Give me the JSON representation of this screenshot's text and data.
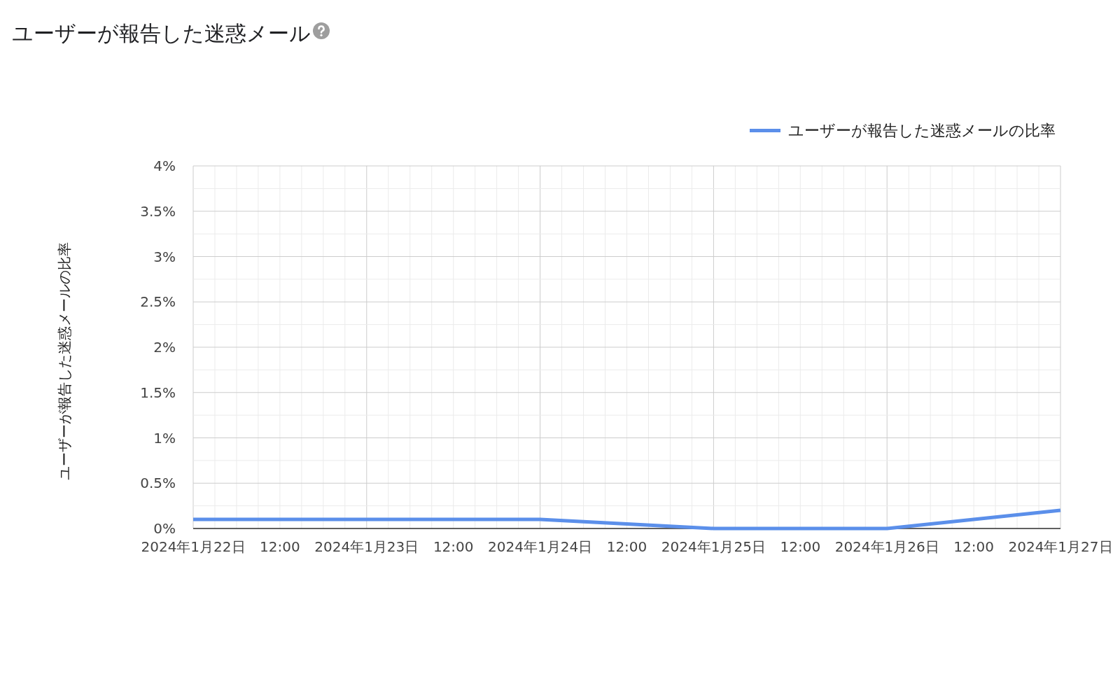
{
  "title": "ユーザーが報告した迷惑メール",
  "chart": {
    "chart_data": {
      "type": "line",
      "ylabel": "ユーザーが報告した迷惑メールの比率",
      "categories": [
        "2024年1月22日",
        "12:00",
        "2024年1月23日",
        "12:00",
        "2024年1月24日",
        "12:00",
        "2024年1月25日",
        "12:00",
        "2024年1月26日",
        "12:00",
        "2024年1月27日"
      ],
      "series": [
        {
          "name": "ユーザーが報告した迷惑メールの比率",
          "color": "#5b8fea",
          "values": [
            0.1,
            0.1,
            0.1,
            0.1,
            0.1,
            0.05,
            0,
            0,
            0,
            0.1,
            0.2
          ]
        }
      ],
      "ylim": [
        0,
        4
      ],
      "grid": true,
      "yticks": [
        {
          "value": 0,
          "label": "0%"
        },
        {
          "value": 0.5,
          "label": "0.5%"
        },
        {
          "value": 1,
          "label": "1%"
        },
        {
          "value": 1.5,
          "label": "1.5%"
        },
        {
          "value": 2,
          "label": "2%"
        },
        {
          "value": 2.5,
          "label": "2.5%"
        },
        {
          "value": 3,
          "label": "3%"
        },
        {
          "value": 3.5,
          "label": "3.5%"
        },
        {
          "value": 4,
          "label": "4%"
        }
      ]
    }
  }
}
